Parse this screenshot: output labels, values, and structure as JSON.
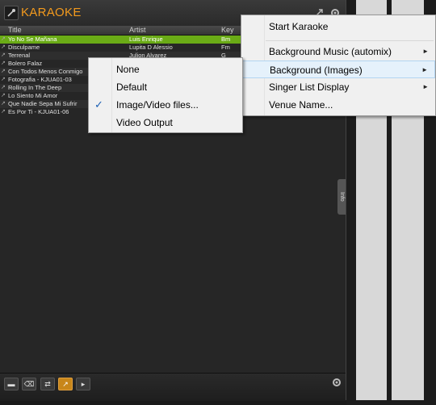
{
  "panel": {
    "title": "KARAOKE",
    "columns": {
      "title": "Title",
      "artist": "Artist",
      "key": "Key"
    },
    "rows": [
      {
        "title": "Yo No Se Mañana",
        "artist": "Luis Enrique",
        "key": "Bm"
      },
      {
        "title": "Disculpame",
        "artist": "Lupita D Alessio",
        "key": "Fm"
      },
      {
        "title": "Terrenal",
        "artist": "Julion Alvarez",
        "key": "G"
      },
      {
        "title": "Bolero Falaz",
        "artist": "",
        "key": ""
      },
      {
        "title": "Con Todos Menos Conmigo",
        "artist": "",
        "key": ""
      },
      {
        "title": "Fotografia - KJUA01-03",
        "artist": "",
        "key": ""
      },
      {
        "title": "Rolling In The Deep",
        "artist": "",
        "key": ""
      },
      {
        "title": "Lo Siento Mi Amor",
        "artist": "",
        "key": ""
      },
      {
        "title": "Que Nadie Sepa Mi Sufrir",
        "artist": "",
        "key": ""
      },
      {
        "title": "Es Por Ti - KJUA01-06",
        "artist": "",
        "key": ""
      }
    ],
    "info_tab": "Info"
  },
  "main_menu": {
    "items": [
      {
        "label": "Start Karaoke",
        "submenu": false
      },
      {
        "label": "Background Music (automix)",
        "submenu": true
      },
      {
        "label": "Background (Images)",
        "submenu": true
      },
      {
        "label": "Singer List Display",
        "submenu": true
      },
      {
        "label": "Venue Name...",
        "submenu": false
      }
    ]
  },
  "sub_menu": {
    "items": [
      {
        "label": "None",
        "checked": false
      },
      {
        "label": "Default",
        "checked": false
      },
      {
        "label": "Image/Video files...",
        "checked": true
      },
      {
        "label": "Video Output",
        "checked": false
      }
    ]
  },
  "icons": {
    "check": "✓",
    "submenu_arrow": "►"
  },
  "colors": {
    "accent": "#f39a1d",
    "selected_row": "#6aab16",
    "menu_highlight": "#e5f1fb"
  }
}
